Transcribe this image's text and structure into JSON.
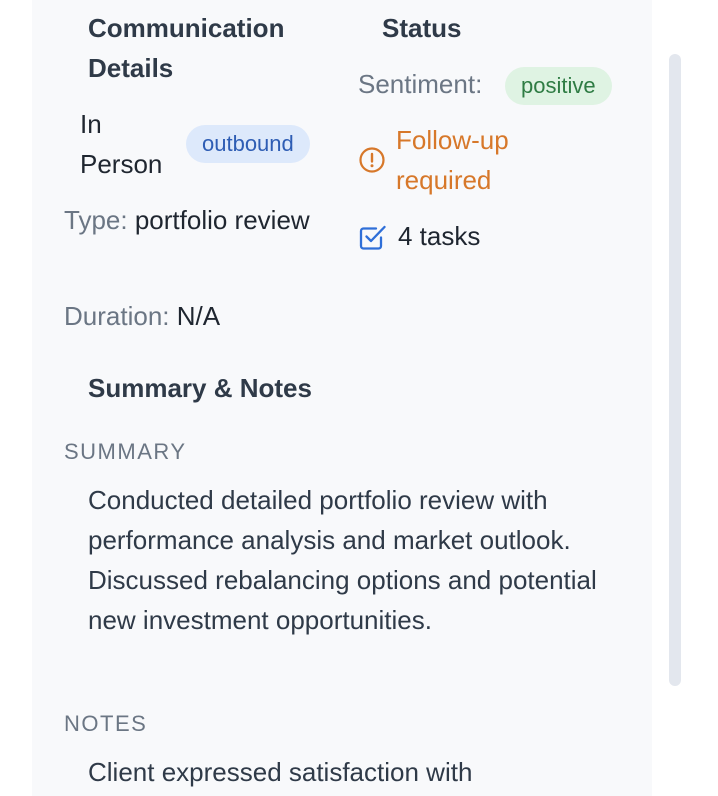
{
  "communication": {
    "title": "Communication Details",
    "channel": "In Person",
    "direction": "outbound",
    "type_label": "Type:",
    "type_value": "portfolio review",
    "duration_label": "Duration:",
    "duration_value": "N/A"
  },
  "status": {
    "title": "Status",
    "sentiment_label": "Sentiment:",
    "sentiment_value": "positive",
    "followup_text": "Follow-up required",
    "followup_icon": "alert-circle-icon",
    "tasks_text": "4 tasks",
    "tasks_icon": "checkbox-icon"
  },
  "notes_section": {
    "title": "Summary & Notes",
    "summary_label": "SUMMARY",
    "summary_text": "Conducted detailed portfolio review with performance analysis and market outlook. Discussed rebalancing options and potential new investment opportunities.",
    "notes_label": "NOTES",
    "notes_text": "Client expressed satisfaction with"
  },
  "colors": {
    "panel_background": "#f8f9fb",
    "direction_badge_bg": "#dde9fb",
    "direction_badge_text": "#2e5db4",
    "sentiment_badge_bg": "#dff3e3",
    "sentiment_badge_text": "#2f7c44",
    "followup": "#d7782a",
    "tasks_icon": "#2f6fd8"
  }
}
